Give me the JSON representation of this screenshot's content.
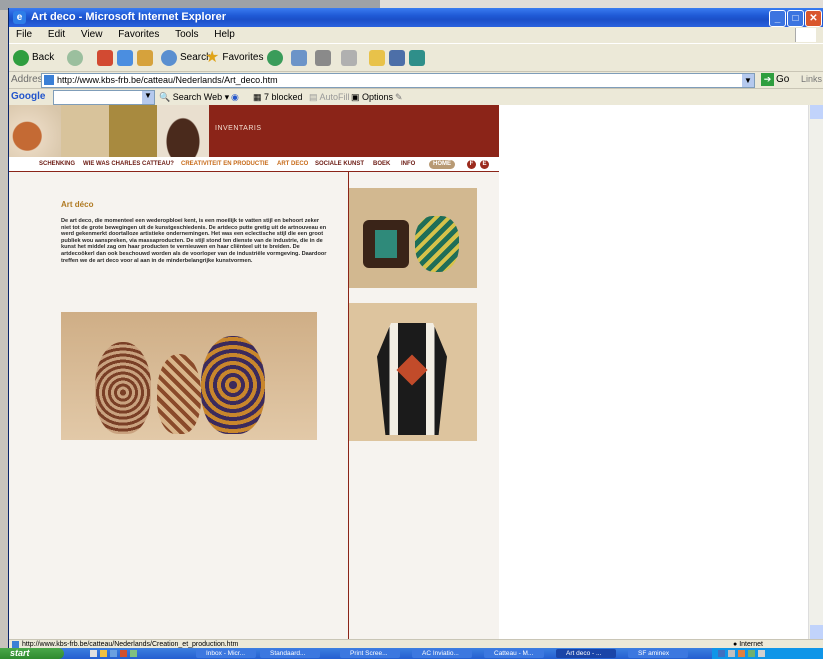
{
  "window": {
    "title": "Art deco - Microsoft Internet Explorer"
  },
  "menu": [
    "File",
    "Edit",
    "View",
    "Favorites",
    "Tools",
    "Help"
  ],
  "toolbar": {
    "back": "Back",
    "search": "Search",
    "favorites": "Favorites"
  },
  "address": {
    "label": "Address",
    "url": "http://www.kbs-frb.be/catteau/Nederlands/Art_deco.htm",
    "go": "Go",
    "links": "Links"
  },
  "google_bar": {
    "logo": "Google",
    "search_web": "Search Web",
    "blocked": "7 blocked",
    "autofill": "AutoFill",
    "options": "Options"
  },
  "site": {
    "banner_label": "INVENTARIS",
    "nav": [
      "SCHENKING",
      "WIE WAS CHARLES CATTEAU?",
      "CREATIVITEIT EN PRODUCTIE",
      "ART DECO",
      "SOCIALE KUNST",
      "BOEK",
      "INFO"
    ],
    "home": "HOME",
    "lang_f": "F",
    "lang_e": "E",
    "page_title": "Art déco",
    "body": "De art deco, die momenteel een wederopbloei kent, is een moeilijk te vatten stijl en behoort zeker niet tot de grote bewegingen uit de kunstgeschiedenis. De artdeco putte gretig uit de artnouveau en werd gekenmerkt doortalloze artistieke ondernemingen. Het was een eclectische stijl die een groot publiek wou aanspreken, via massaproducten. De stijl stond ten dienste van de industrie, die in de kunst het middel zag om haar producten te vernieuwen en haar cliënteel uit te breiden. De artdecoökerl dan ook beschouwd worden als de voorloper van de industriële vormgeving. Daardoor treffen we de art deco voor al aan in de minderbelangrijke kunstvormen."
  },
  "status": {
    "url": "http://www.kbs-frb.be/catteau/Nederlands/Creation_et_production.htm",
    "zone": "Internet"
  },
  "taskbar": {
    "start": "start",
    "tasks": [
      "Inbox - Micr...",
      "Standaard...",
      "Print Scree...",
      "AC Inviatio...",
      "Catteau - M...",
      "Art deco - ...",
      "SF aminex"
    ]
  },
  "colors": {
    "banner": "#8b2418",
    "nav_active": "#c76a18",
    "title": "#b07a22"
  }
}
